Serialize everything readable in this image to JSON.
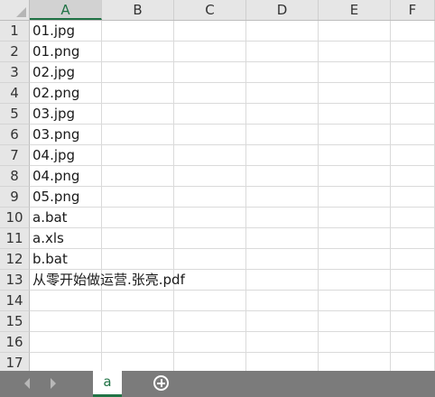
{
  "columns": [
    "A",
    "B",
    "C",
    "D",
    "E",
    "F"
  ],
  "rows": [
    {
      "num": "1",
      "a": "01.jpg"
    },
    {
      "num": "2",
      "a": "01.png"
    },
    {
      "num": "3",
      "a": "02.jpg"
    },
    {
      "num": "4",
      "a": "02.png"
    },
    {
      "num": "5",
      "a": "03.jpg"
    },
    {
      "num": "6",
      "a": "03.png"
    },
    {
      "num": "7",
      "a": "04.jpg"
    },
    {
      "num": "8",
      "a": "04.png"
    },
    {
      "num": "9",
      "a": "05.png"
    },
    {
      "num": "10",
      "a": "a.bat"
    },
    {
      "num": "11",
      "a": "a.xls"
    },
    {
      "num": "12",
      "a": "b.bat"
    },
    {
      "num": "13",
      "a": "从零开始做运营.张亮.pdf"
    },
    {
      "num": "14",
      "a": ""
    },
    {
      "num": "15",
      "a": ""
    },
    {
      "num": "16",
      "a": ""
    },
    {
      "num": "17",
      "a": ""
    }
  ],
  "tabs": {
    "active_sheet": "a",
    "prev_icon": "chevron-left-icon",
    "next_icon": "chevron-right-icon",
    "add_icon": "plus-circle-icon"
  },
  "colors": {
    "accent": "#217346",
    "header_bg": "#e6e6e6",
    "tabbar_bg": "#7b7b7b"
  }
}
